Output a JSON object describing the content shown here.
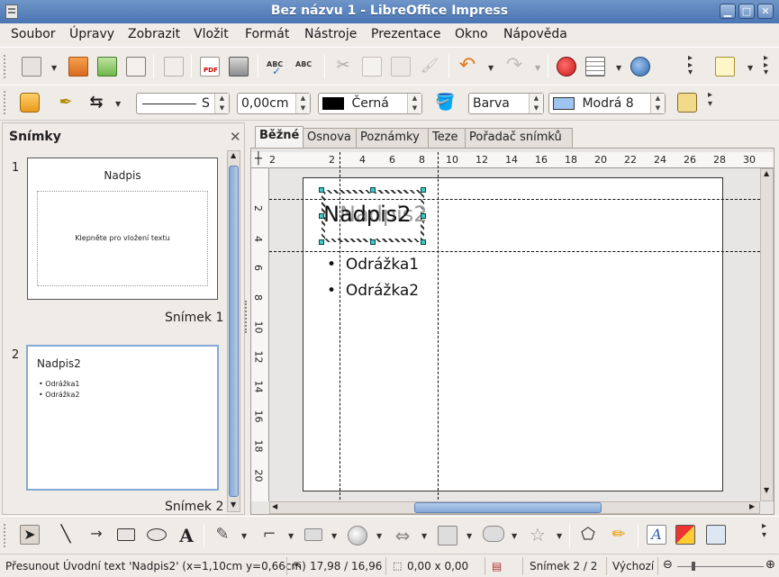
{
  "window": {
    "title": "Bez názvu 1 - LibreOffice Impress"
  },
  "menu": [
    "Soubor",
    "Úpravy",
    "Zobrazit",
    "Vložit",
    "Formát",
    "Nástroje",
    "Prezentace",
    "Okno",
    "Nápověda"
  ],
  "format_bar": {
    "line_style": "S",
    "line_width": "0,00cm",
    "line_color": "Černá",
    "area_type": "Barva",
    "area_color": "Modrá 8"
  },
  "slides_panel": {
    "title": "Snímky",
    "slides": [
      {
        "number": "1",
        "label": "Snímek 1",
        "title": "Nadpis",
        "body": "Klepněte pro vložení textu",
        "bullets": []
      },
      {
        "number": "2",
        "label": "Snímek 2",
        "title": "Nadpis2",
        "body": "",
        "bullets": [
          "Odrážka1",
          "Odrážka2"
        ]
      }
    ]
  },
  "view_tabs": [
    "Běžné",
    "Osnova",
    "Poznámky",
    "Teze",
    "Pořadač snímků"
  ],
  "active_tab": "Běžné",
  "rulers": {
    "horizontal": [
      "2",
      "2",
      "4",
      "6",
      "8",
      "10",
      "12",
      "14",
      "16",
      "18",
      "20",
      "22",
      "24",
      "26",
      "28",
      "30"
    ],
    "vertical": [
      "2",
      "4",
      "6",
      "8",
      "10",
      "12",
      "14",
      "16",
      "18",
      "20"
    ]
  },
  "slide": {
    "title": "Nadpis2",
    "title_ghost": "Nadpis2",
    "bullets": [
      "Odrážka1",
      "Odrážka2"
    ]
  },
  "status": {
    "message": "Přesunout Úvodní text 'Nadpis2' (x=1,10cm y=0,66cm)",
    "position": "17,98 / 16,96",
    "size": "0,00 x 0,00",
    "slide": "Snímek 2 / 2",
    "layout": "Výchozí"
  },
  "colors": {
    "accent": "#86a8d6",
    "titlebar": "#5a82bb",
    "handle": "#3ecaca",
    "area_color": "#9ec5f0"
  }
}
